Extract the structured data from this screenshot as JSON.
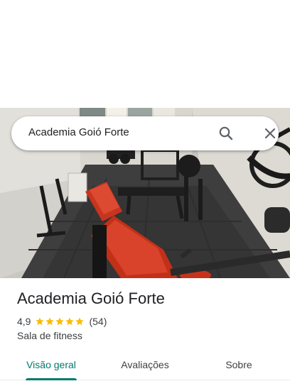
{
  "search": {
    "query": "Academia Goió Forte",
    "search_icon": "search-icon",
    "close_icon": "close-icon"
  },
  "place": {
    "name": "Academia Goió Forte",
    "rating": "4,9",
    "stars": 5,
    "review_count": "(54)",
    "category": "Sala de fitness"
  },
  "tabs": [
    {
      "label": "Visão geral",
      "active": true
    },
    {
      "label": "Avaliações",
      "active": false
    },
    {
      "label": "Sobre",
      "active": false
    }
  ],
  "colors": {
    "accent": "#00796b",
    "star": "#fbbc04",
    "text_primary": "#202124",
    "text_secondary": "#3c4043"
  }
}
